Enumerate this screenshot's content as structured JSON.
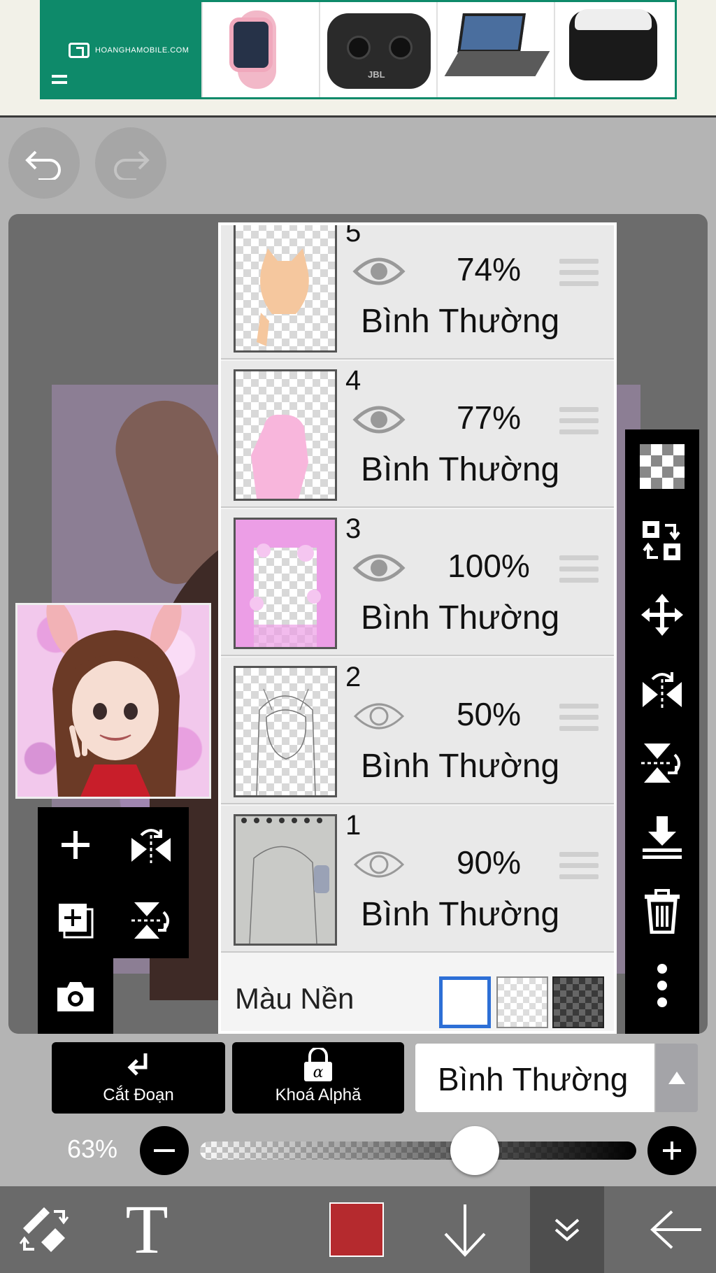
{
  "ad": {
    "brand_text": "HOANGHAMOBILE.COM",
    "product_brand": "JBL",
    "products": [
      "smart-watch",
      "earbuds",
      "tablet-keyboard",
      "earbuds-case"
    ]
  },
  "history": {
    "undo_icon": "undo-icon",
    "redo_icon": "redo-icon"
  },
  "layers": [
    {
      "number": "5",
      "opacity": "74%",
      "mode": "Bình Thường",
      "visible": true
    },
    {
      "number": "4",
      "opacity": "77%",
      "mode": "Bình Thường",
      "visible": true
    },
    {
      "number": "3",
      "opacity": "100%",
      "mode": "Bình Thường",
      "visible": true
    },
    {
      "number": "2",
      "opacity": "50%",
      "mode": "Bình Thường",
      "visible": false
    },
    {
      "number": "1",
      "opacity": "90%",
      "mode": "Bình Thường",
      "visible": false
    }
  ],
  "background": {
    "label": "Màu Nền",
    "options": [
      "white",
      "transparent",
      "dark-checker"
    ],
    "selected": "white",
    "selected_color": "#2d6fd6"
  },
  "right_tools": [
    "transparency-icon",
    "swap-layer-icon",
    "move-icon",
    "flip-horizontal-icon",
    "flip-vertical-icon",
    "merge-down-icon",
    "trash-icon",
    "more-icon"
  ],
  "left_tools": [
    "add-layer-icon",
    "flip-horizontal-icon",
    "duplicate-layer-icon",
    "flip-vertical-icon",
    "camera-icon"
  ],
  "actions": {
    "clip_label": "Cắt Đoạn",
    "alpha_lock_label": "Khoá Alphă",
    "blend_mode": "Bình Thường"
  },
  "opacity": {
    "label": "63%",
    "value": 0.63
  },
  "bottom_bar": {
    "text_tool": "T",
    "current_color": "#b52a2e",
    "icons": [
      "swap-tools-icon",
      "text-tool-icon",
      "color-swatch",
      "arrow-down-icon",
      "collapse-icon",
      "back-arrow-icon"
    ]
  }
}
